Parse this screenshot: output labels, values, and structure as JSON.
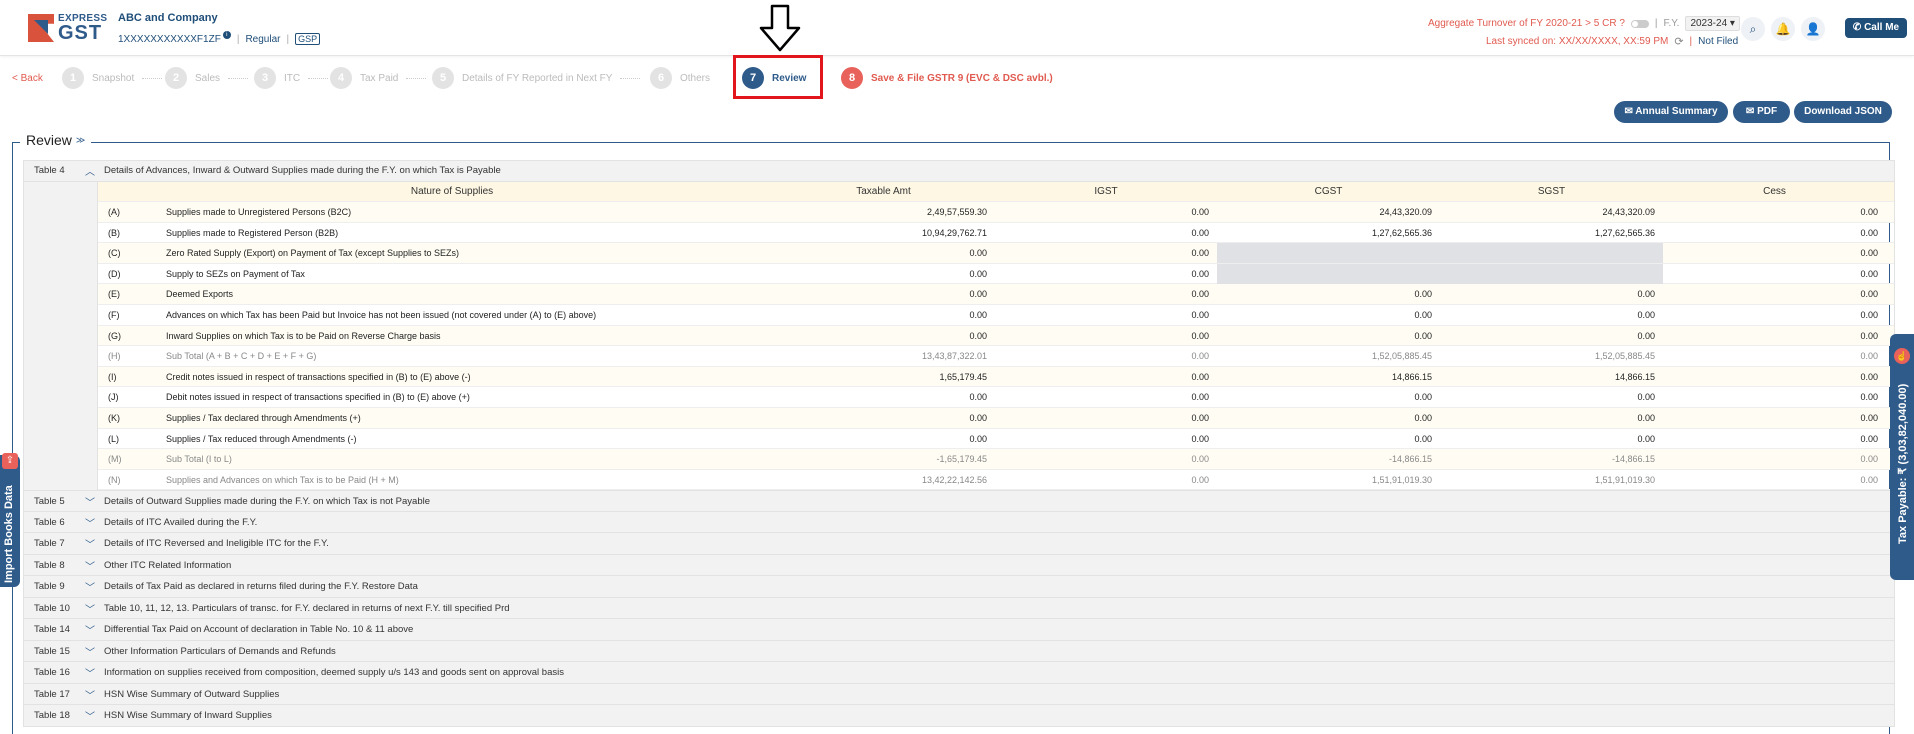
{
  "logo": {
    "top": "EXPRESS",
    "bottom": "GST"
  },
  "company": {
    "name": "ABC and Company",
    "gstin": "1XXXXXXXXXXXF1ZF",
    "info": "i",
    "type": "Regular",
    "gsp": "GSP"
  },
  "header": {
    "turnover": "Aggregate Turnover of FY 2020-21 > 5 CR ?",
    "fy_label": "F.Y.",
    "fy_value": "2023-24 ▾",
    "last_synced": "Last synced on: XX/XX/XXXX, XX:59 PM",
    "status": "Not Filed",
    "call_me": "Call Me",
    "sep": "|"
  },
  "stepper": {
    "back": "< Back",
    "steps": [
      {
        "num": "1",
        "label": "Snapshot"
      },
      {
        "num": "2",
        "label": "Sales"
      },
      {
        "num": "3",
        "label": "ITC"
      },
      {
        "num": "4",
        "label": "Tax Paid"
      },
      {
        "num": "5",
        "label": "Details of FY Reported in Next FY"
      },
      {
        "num": "6",
        "label": "Others"
      },
      {
        "num": "7",
        "label": "Review"
      },
      {
        "num": "8",
        "label": "Save & File GSTR 9 (EVC & DSC avbl.)"
      }
    ]
  },
  "actions": {
    "annual_summary": "✉ Annual Summary",
    "pdf": "✉ PDF",
    "download_json": "Download JSON"
  },
  "review": {
    "title": "Review",
    "chevron": "≫"
  },
  "table4": {
    "name": "Table 4",
    "chevron": "︿",
    "description": "Details of Advances, Inward & Outward Supplies made during the F.Y. on which Tax is Payable",
    "columns": [
      "",
      "Nature of Supplies",
      "Taxable Amt",
      "IGST",
      "CGST",
      "SGST",
      "Cess"
    ],
    "rows": [
      {
        "code": "(A)",
        "nature": "Supplies made to Unregistered Persons (B2C)",
        "taxable": "2,49,57,559.30",
        "igst": "0.00",
        "cgst": "24,43,320.09",
        "sgst": "24,43,320.09",
        "cess": "0.00"
      },
      {
        "code": "(B)",
        "nature": "Supplies made to Registered Person (B2B)",
        "taxable": "10,94,29,762.71",
        "igst": "0.00",
        "cgst": "1,27,62,565.36",
        "sgst": "1,27,62,565.36",
        "cess": "0.00"
      },
      {
        "code": "(C)",
        "nature": "Zero Rated Supply (Export) on Payment of Tax (except Supplies to SEZs)",
        "taxable": "0.00",
        "igst": "0.00",
        "cgst": "",
        "sgst": "",
        "cess": "0.00"
      },
      {
        "code": "(D)",
        "nature": "Supply to SEZs on Payment of Tax",
        "taxable": "0.00",
        "igst": "0.00",
        "cgst": "",
        "sgst": "",
        "cess": "0.00"
      },
      {
        "code": "(E)",
        "nature": "Deemed Exports",
        "taxable": "0.00",
        "igst": "0.00",
        "cgst": "0.00",
        "sgst": "0.00",
        "cess": "0.00"
      },
      {
        "code": "(F)",
        "nature": "Advances on which Tax has been Paid but Invoice has not been issued (not covered under (A) to (E) above)",
        "taxable": "0.00",
        "igst": "0.00",
        "cgst": "0.00",
        "sgst": "0.00",
        "cess": "0.00"
      },
      {
        "code": "(G)",
        "nature": "Inward Supplies on which Tax is to be Paid on Reverse Charge basis",
        "taxable": "0.00",
        "igst": "0.00",
        "cgst": "0.00",
        "sgst": "0.00",
        "cess": "0.00"
      },
      {
        "code": "(H)",
        "nature": "Sub Total (A + B + C + D + E + F + G)",
        "taxable": "13,43,87,322.01",
        "igst": "0.00",
        "cgst": "1,52,05,885.45",
        "sgst": "1,52,05,885.45",
        "cess": "0.00"
      },
      {
        "code": "(I)",
        "nature": "Credit notes issued in respect of transactions specified in (B) to (E) above (-)",
        "taxable": "1,65,179.45",
        "igst": "0.00",
        "cgst": "14,866.15",
        "sgst": "14,866.15",
        "cess": "0.00"
      },
      {
        "code": "(J)",
        "nature": "Debit notes issued in respect of transactions specified in (B) to (E) above (+)",
        "taxable": "0.00",
        "igst": "0.00",
        "cgst": "0.00",
        "sgst": "0.00",
        "cess": "0.00"
      },
      {
        "code": "(K)",
        "nature": "Supplies / Tax declared through Amendments (+)",
        "taxable": "0.00",
        "igst": "0.00",
        "cgst": "0.00",
        "sgst": "0.00",
        "cess": "0.00"
      },
      {
        "code": "(L)",
        "nature": "Supplies / Tax reduced through Amendments (-)",
        "taxable": "0.00",
        "igst": "0.00",
        "cgst": "0.00",
        "sgst": "0.00",
        "cess": "0.00"
      },
      {
        "code": "(M)",
        "nature": "Sub Total (I to L)",
        "taxable": "-1,65,179.45",
        "igst": "0.00",
        "cgst": "-14,866.15",
        "sgst": "-14,866.15",
        "cess": "0.00"
      },
      {
        "code": "(N)",
        "nature": "Supplies and Advances on which Tax is to be Paid (H + M)",
        "taxable": "13,42,22,142.56",
        "igst": "0.00",
        "cgst": "1,51,91,019.30",
        "sgst": "1,51,91,019.30",
        "cess": "0.00"
      }
    ]
  },
  "sections": [
    {
      "name": "Table 5",
      "chevron": "﹀",
      "description": "Details of Outward Supplies made during the F.Y. on which Tax is not Payable"
    },
    {
      "name": "Table 6",
      "chevron": "﹀",
      "description": "Details of ITC Availed during the F.Y."
    },
    {
      "name": "Table 7",
      "chevron": "﹀",
      "description": "Details of ITC Reversed and Ineligible ITC for the F.Y."
    },
    {
      "name": "Table 8",
      "chevron": "﹀",
      "description": "Other ITC Related Information"
    },
    {
      "name": "Table 9",
      "chevron": "﹀",
      "description": "Details of Tax Paid as declared in returns filed during the F.Y. Restore Data"
    },
    {
      "name": "Table 10",
      "chevron": "﹀",
      "description": "Table 10, 11, 12, 13. Particulars of transc. for F.Y. declared in returns of next F.Y. till specified Prd"
    },
    {
      "name": "Table 14",
      "chevron": "﹀",
      "description": "Differential Tax Paid on Account of declaration in Table No. 10 & 11 above"
    },
    {
      "name": "Table 15",
      "chevron": "﹀",
      "description": "Other Information Particulars of Demands and Refunds"
    },
    {
      "name": "Table 16",
      "chevron": "﹀",
      "description": "Information on supplies received from composition, deemed supply u/s 143 and goods sent on approval basis"
    },
    {
      "name": "Table 17",
      "chevron": "﹀",
      "description": "HSN Wise Summary of Outward Supplies"
    },
    {
      "name": "Table 18",
      "chevron": "﹀",
      "description": "HSN Wise Summary of Inward Supplies"
    }
  ],
  "side": {
    "import_books": "Import Books Data",
    "tax_payable": "Tax Payable: ₹ (3,03,82,040.00)"
  },
  "icons": {
    "search": "⌕",
    "bell": "🔔",
    "user": "👤",
    "phone": "✆",
    "sync": "⟳",
    "import": "⇪",
    "hand": "☝"
  },
  "colors": {
    "brand": "#2f5b8a",
    "accent": "#e05a4f",
    "highlight_box": "#e3151c"
  }
}
